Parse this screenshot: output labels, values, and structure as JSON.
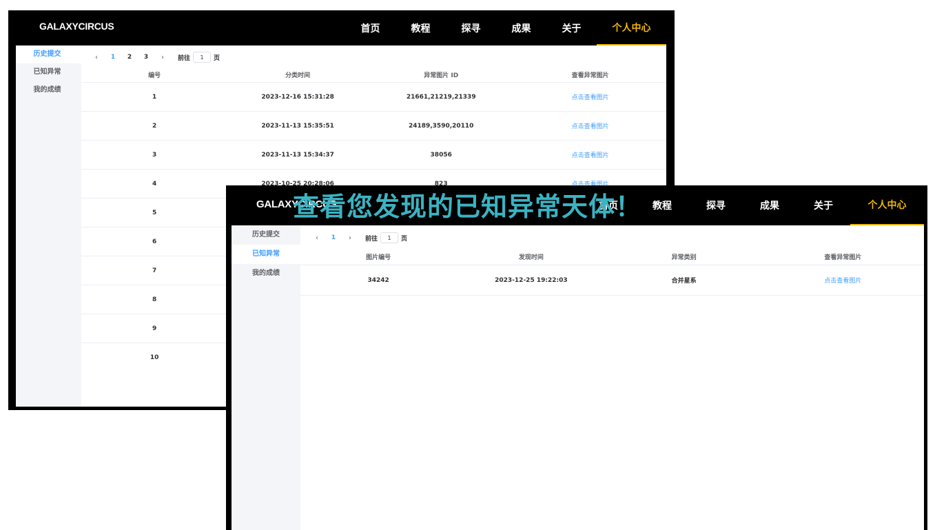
{
  "back_window": {
    "logo": "GALAXYCIRCUS",
    "nav": [
      "首页",
      "教程",
      "探寻",
      "成果",
      "关于",
      "个人中心"
    ],
    "sidebar": [
      "历史提交",
      "已知异常",
      "我的成绩"
    ],
    "pagination": {
      "prev": "‹",
      "pages": [
        "1",
        "2",
        "3"
      ],
      "next": "›",
      "goto_label": "前往",
      "goto_value": "1",
      "goto_suffix": "页"
    },
    "table": {
      "headers": [
        "编号",
        "分类时间",
        "异常图片 ID",
        "查看异常图片"
      ],
      "rows": [
        [
          "1",
          "2023-12-16 15:31:28",
          "21661,21219,21339",
          "点击查看图片"
        ],
        [
          "2",
          "2023-11-13 15:35:51",
          "24189,3590,20110",
          "点击查看图片"
        ],
        [
          "3",
          "2023-11-13 15:34:37",
          "38056",
          "点击查看图片"
        ],
        [
          "4",
          "2023-10-25 20:28:06",
          "823",
          "点击查看图片"
        ],
        [
          "5",
          "",
          "",
          ""
        ],
        [
          "6",
          "",
          "",
          ""
        ],
        [
          "7",
          "",
          "",
          ""
        ],
        [
          "8",
          "",
          "",
          ""
        ],
        [
          "9",
          "",
          "",
          ""
        ],
        [
          "10",
          "",
          "",
          ""
        ]
      ]
    }
  },
  "front_window": {
    "logo": "GALAXYCIRCUS",
    "nav": [
      "首页",
      "教程",
      "探寻",
      "成果",
      "关于",
      "个人中心"
    ],
    "sidebar": [
      "历史提交",
      "已知异常",
      "我的成绩"
    ],
    "pagination": {
      "prev": "‹",
      "pages": [
        "1"
      ],
      "next": "›",
      "goto_label": "前往",
      "goto_value": "1",
      "goto_suffix": "页"
    },
    "table": {
      "headers": [
        "图片编号",
        "发现时间",
        "异常类别",
        "查看异常图片"
      ],
      "rows": [
        [
          "34242",
          "2023-12-25 19:22:03",
          "合并星系",
          "点击查看图片"
        ]
      ]
    }
  },
  "banner": "查看您发现的已知异常天体！",
  "colors": {
    "accent_nav": "#f2b705",
    "link": "#409eff",
    "banner": "#3bb3c3"
  }
}
